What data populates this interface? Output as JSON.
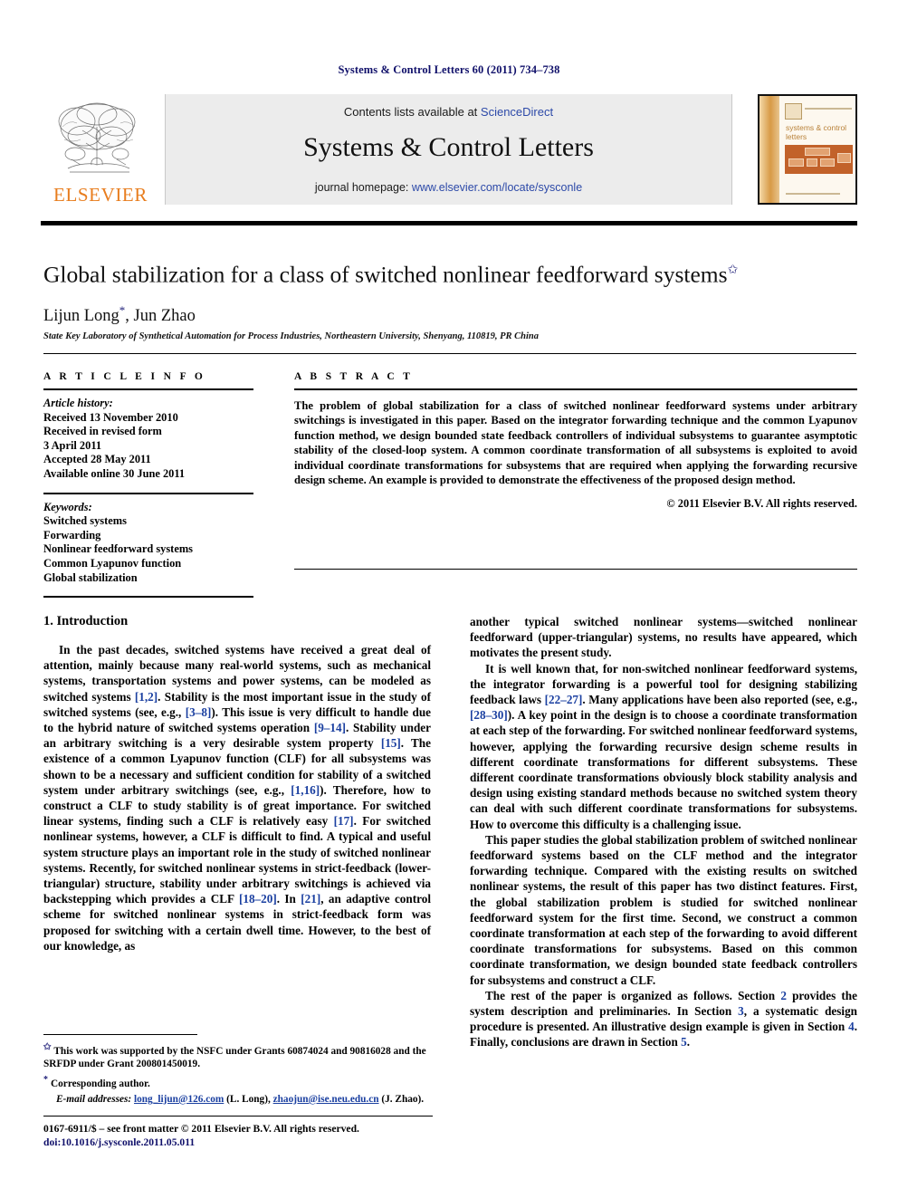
{
  "running_head": "Systems & Control Letters 60 (2011) 734–738",
  "journal_header": {
    "publisher_name": "ELSEVIER",
    "contents_prefix": "Contents lists available at ",
    "contents_link": "ScienceDirect",
    "journal_title": "Systems & Control Letters",
    "homepage_prefix": "journal homepage: ",
    "homepage_link": "www.elsevier.com/locate/sysconle",
    "cover_title": "systems & control letters"
  },
  "article": {
    "title": "Global stabilization for a class of switched nonlinear feedforward systems",
    "title_footnote_mark": "✩",
    "authors": "Lijun Long",
    "author_star": "*",
    "authors_rest": ", Jun Zhao",
    "affiliation": "State Key Laboratory of Synthetical Automation for Process Industries, Northeastern University, Shenyang, 110819, PR China"
  },
  "info": {
    "heading": "A R T I C L E   I N F O",
    "history_label": "Article history:",
    "history": [
      "Received 13 November 2010",
      "Received in revised form",
      "3 April 2011",
      "Accepted 28 May 2011",
      "Available online 30 June 2011"
    ],
    "keywords_label": "Keywords:",
    "keywords": [
      "Switched systems",
      "Forwarding",
      "Nonlinear feedforward systems",
      "Common Lyapunov function",
      "Global stabilization"
    ]
  },
  "abstract": {
    "heading": "A B S T R A C T",
    "text": "The problem of global stabilization for a class of switched nonlinear feedforward systems under arbitrary switchings is investigated in this paper. Based on the integrator forwarding technique and the common Lyapunov function method, we design bounded state feedback controllers of individual subsystems to guarantee asymptotic stability of the closed-loop system. A common coordinate transformation of all subsystems is exploited to avoid individual coordinate transformations for subsystems that are required when applying the forwarding recursive design scheme. An example is provided to demonstrate the effectiveness of the proposed design method.",
    "copyright": "© 2011 Elsevier B.V. All rights reserved."
  },
  "body": {
    "section_title": "1. Introduction",
    "left_paragraphs": [
      "In the past decades, switched systems have received a great deal of attention, mainly because many real-world systems, such as mechanical systems, transportation systems and power systems, can be modeled as switched systems [1,2]. Stability is the most important issue in the study of switched systems (see, e.g., [3–8]). This issue is very difficult to handle due to the hybrid nature of switched systems operation [9–14]. Stability under an arbitrary switching is a very desirable system property [15]. The existence of a common Lyapunov function (CLF) for all subsystems was shown to be a necessary and sufficient condition for stability of a switched system under arbitrary switchings (see, e.g., [1,16]). Therefore, how to construct a CLF to study stability is of great importance. For switched linear systems, finding such a CLF is relatively easy [17]. For switched nonlinear systems, however, a CLF is difficult to find. A typical and useful system structure plays an important role in the study of switched nonlinear systems. Recently, for switched nonlinear systems in strict-feedback (lower-triangular) structure, stability under arbitrary switchings is achieved via backstepping which provides a CLF [18–20]. In [21], an adaptive control scheme for switched nonlinear systems in strict-feedback form was proposed for switching with a certain dwell time. However, to the best of our knowledge, as"
    ],
    "right_paragraphs": [
      "another typical switched nonlinear systems—switched nonlinear feedforward (upper-triangular) systems, no results have appeared, which motivates the present study.",
      "It is well known that, for non-switched nonlinear feedforward systems, the integrator forwarding is a powerful tool for designing stabilizing feedback laws [22–27]. Many applications have been also reported (see, e.g., [28–30]). A key point in the design is to choose a coordinate transformation at each step of the forwarding. For switched nonlinear feedforward systems, however, applying the forwarding recursive design scheme results in different coordinate transformations for different subsystems. These different coordinate transformations obviously block stability analysis and design using existing standard methods because no switched system theory can deal with such different coordinate transformations for subsystems. How to overcome this difficulty is a challenging issue.",
      "This paper studies the global stabilization problem of switched nonlinear feedforward systems based on the CLF method and the integrator forwarding technique. Compared with the existing results on switched nonlinear systems, the result of this paper has two distinct features. First, the global stabilization problem is studied for switched nonlinear feedforward system for the first time. Second, we construct a common coordinate transformation at each step of the forwarding to avoid different coordinate transformations for subsystems. Based on this common coordinate transformation, we design bounded state feedback controllers for subsystems and construct a CLF.",
      "The rest of the paper is organized as follows. Section 2 provides the system description and preliminaries. In Section 3, a systematic design procedure is presented. An illustrative design example is given in Section 4. Finally, conclusions are drawn in Section 5."
    ]
  },
  "footnotes": {
    "funding_mark": "✩",
    "funding": "This work was supported by the NSFC under Grants 60874024 and 90816028 and the SRFDP under Grant 200801450019.",
    "corresponding_mark": "*",
    "corresponding": "Corresponding author.",
    "email_label": "E-mail addresses:",
    "email1": "long_lijun@126.com",
    "email1_owner": "(L. Long),",
    "email2": "zhaojun@ise.neu.edu.cn",
    "email2_owner": "(J. Zhao)."
  },
  "footer": {
    "issn_line": "0167-6911/$ – see front matter © 2011 Elsevier B.V. All rights reserved.",
    "doi_line": "doi:10.1016/j.sysconle.2011.05.011"
  },
  "colors": {
    "link": "#2c49a8",
    "reference": "#1a3fa0",
    "running_head": "#10106a",
    "elsevier_orange": "#e87d1e"
  }
}
